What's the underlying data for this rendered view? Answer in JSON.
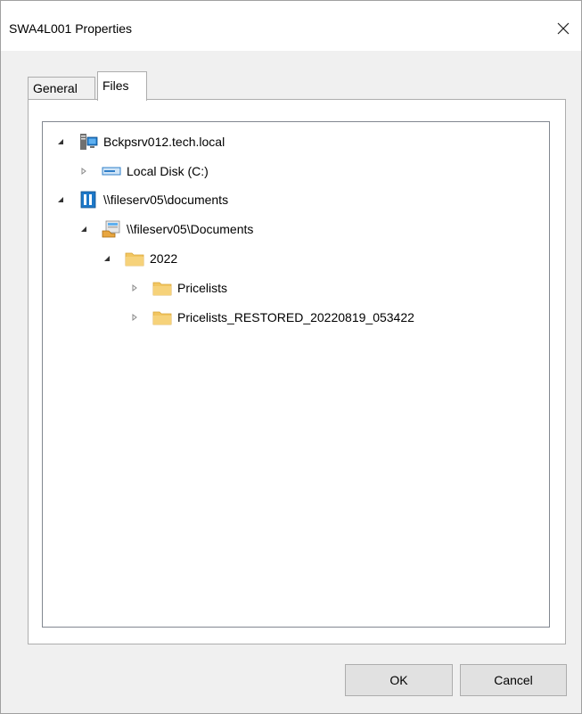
{
  "window": {
    "title": "SWA4L001 Properties",
    "close_icon": "close-icon"
  },
  "tabs": [
    {
      "label": "General",
      "active": false
    },
    {
      "label": "Files",
      "active": true
    }
  ],
  "tree": {
    "items": [
      {
        "label": "Bckpsrv012.tech.local",
        "icon": "server-icon",
        "state": "expanded"
      },
      {
        "label": "Local Disk (C:)",
        "icon": "drive-icon",
        "state": "collapsed"
      },
      {
        "label": "\\\\fileserv05\\documents",
        "icon": "nas-icon",
        "state": "expanded"
      },
      {
        "label": "\\\\fileserv05\\Documents",
        "icon": "share-icon",
        "state": "expanded"
      },
      {
        "label": "2022",
        "icon": "folder-icon",
        "state": "expanded"
      },
      {
        "label": "Pricelists",
        "icon": "folder-icon",
        "state": "collapsed"
      },
      {
        "label": "Pricelists_RESTORED_20220819_053422",
        "icon": "folder-icon",
        "state": "collapsed"
      }
    ]
  },
  "buttons": {
    "ok_label": "OK",
    "cancel_label": "Cancel"
  },
  "colors": {
    "folder": "#f2c661",
    "accent": "#1e78c8",
    "border": "#adadad"
  }
}
